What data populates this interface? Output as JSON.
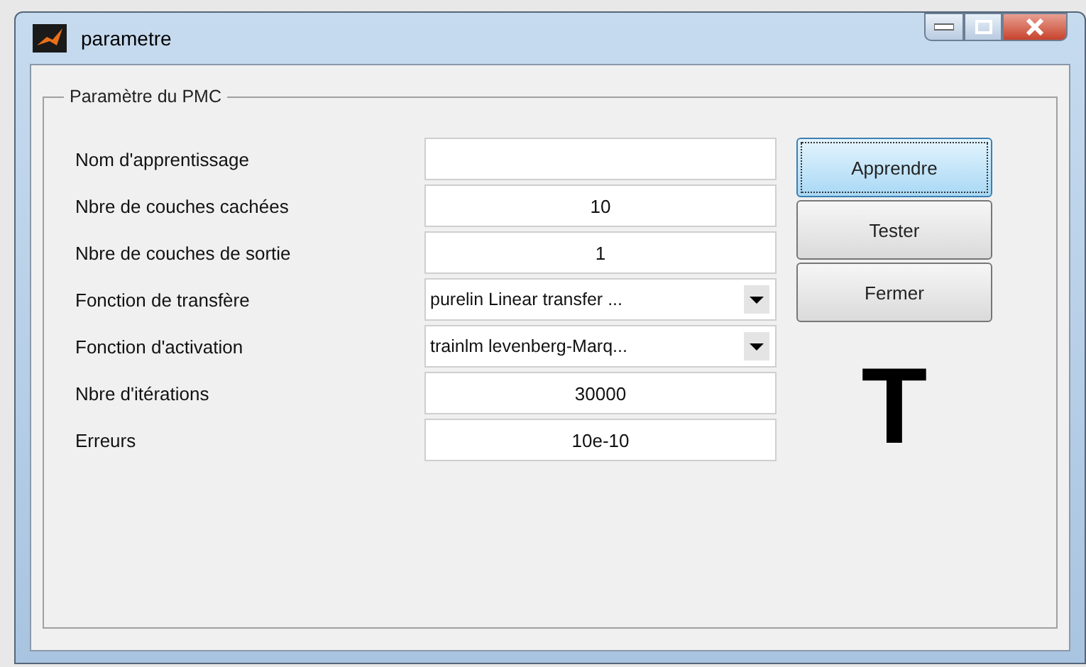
{
  "window": {
    "title": "parametre"
  },
  "group": {
    "title": "Paramètre du PMC"
  },
  "fields": [
    {
      "label": "Nom d'apprentissage",
      "kind": "text"
    },
    {
      "label": "Nbre de couches cachées",
      "kind": "text",
      "value": "10"
    },
    {
      "label": "Nbre de couches de sortie",
      "kind": "text",
      "value": "1"
    },
    {
      "label": "Fonction de transfère",
      "kind": "dropdown",
      "value": "purelin Linear transfer ..."
    },
    {
      "label": "Fonction d'activation",
      "kind": "dropdown",
      "value": "trainlm levenberg-Marq..."
    },
    {
      "label": "Nbre d'itérations",
      "kind": "text",
      "value": "30000"
    },
    {
      "label": "Erreurs",
      "kind": "text",
      "value": "10e-10"
    }
  ],
  "buttons": [
    {
      "label": "Apprendre",
      "focused": true
    },
    {
      "label": "Tester",
      "focused": false
    },
    {
      "label": "Fermer",
      "focused": false
    }
  ],
  "big_letter": "T"
}
